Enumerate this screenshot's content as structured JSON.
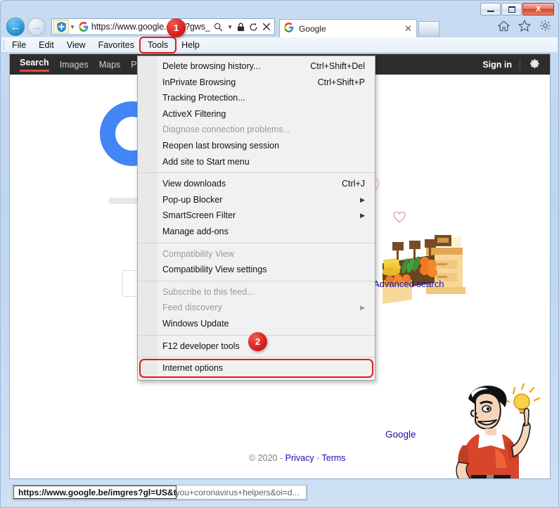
{
  "window": {
    "minimize_label": "Minimize",
    "maximize_label": "Maximize",
    "close_label": "X"
  },
  "navigation": {
    "back_label": "←",
    "forward_label": "→",
    "shield_icon": "tracking-protection-shield-icon",
    "url": "https://www.google.com/?gws_",
    "search_icon": "search-magnifier-icon",
    "dropdown_icon": "chevron-down-icon",
    "lock_icon": "padlock-icon",
    "refresh_icon": "refresh-icon",
    "stop_icon": "stop-x-icon"
  },
  "tabs": {
    "items": [
      {
        "title": "Google",
        "favicon": "google-g-favicon",
        "close_label": "✕"
      }
    ],
    "new_tab_label": "New Tab"
  },
  "toolbar_icons": [
    {
      "name": "home-icon",
      "glyph": "⌂"
    },
    {
      "name": "favorites-star-icon",
      "glyph": "☆"
    },
    {
      "name": "settings-gear-icon",
      "glyph": "⚙"
    }
  ],
  "menubar": {
    "items": [
      {
        "label": "File"
      },
      {
        "label": "Edit"
      },
      {
        "label": "View"
      },
      {
        "label": "Favorites"
      },
      {
        "label": "Tools",
        "highlighted": true
      },
      {
        "label": "Help"
      }
    ]
  },
  "tools_menu": {
    "groups": [
      {
        "items": [
          {
            "label": "Delete browsing history...",
            "accel": "Ctrl+Shift+Del",
            "disabled": false,
            "submenu": false
          },
          {
            "label": "InPrivate Browsing",
            "accel": "Ctrl+Shift+P",
            "disabled": false,
            "submenu": false
          },
          {
            "label": "Tracking Protection...",
            "accel": "",
            "disabled": false,
            "submenu": false
          },
          {
            "label": "ActiveX Filtering",
            "accel": "",
            "disabled": false,
            "submenu": false
          },
          {
            "label": "Diagnose connection problems...",
            "accel": "",
            "disabled": true,
            "submenu": false
          },
          {
            "label": "Reopen last browsing session",
            "accel": "",
            "disabled": false,
            "submenu": false
          },
          {
            "label": "Add site to Start menu",
            "accel": "",
            "disabled": false,
            "submenu": false
          }
        ]
      },
      {
        "items": [
          {
            "label": "View downloads",
            "accel": "Ctrl+J",
            "disabled": false,
            "submenu": false
          },
          {
            "label": "Pop-up Blocker",
            "accel": "",
            "disabled": false,
            "submenu": true
          },
          {
            "label": "SmartScreen Filter",
            "accel": "",
            "disabled": false,
            "submenu": true
          },
          {
            "label": "Manage add-ons",
            "accel": "",
            "disabled": false,
            "submenu": false
          }
        ]
      },
      {
        "items": [
          {
            "label": "Compatibility View",
            "accel": "",
            "disabled": true,
            "submenu": false
          },
          {
            "label": "Compatibility View settings",
            "accel": "",
            "disabled": false,
            "submenu": false
          }
        ]
      },
      {
        "items": [
          {
            "label": "Subscribe to this feed...",
            "accel": "",
            "disabled": true,
            "submenu": false
          },
          {
            "label": "Feed discovery",
            "accel": "",
            "disabled": true,
            "submenu": true
          },
          {
            "label": "Windows Update",
            "accel": "",
            "disabled": false,
            "submenu": false
          }
        ]
      },
      {
        "items": [
          {
            "label": "F12 developer tools",
            "accel": "",
            "disabled": false,
            "submenu": false
          }
        ]
      },
      {
        "items": [
          {
            "label": "Internet options",
            "accel": "",
            "disabled": false,
            "submenu": false,
            "highlighted": true
          }
        ]
      }
    ]
  },
  "badges": [
    {
      "id": "badge-1",
      "label": "1"
    },
    {
      "id": "badge-2",
      "label": "2"
    }
  ],
  "page": {
    "gbar": {
      "links": [
        {
          "label": "Search",
          "active": true
        },
        {
          "label": "Images",
          "active": false
        },
        {
          "label": "Maps",
          "active": false
        },
        {
          "label": "Play",
          "active": false
        }
      ],
      "signin_label": "Sign in",
      "gear_icon": "google-settings-gear-icon"
    },
    "doodle": {
      "alt": "Thank you coronavirus helpers - grocery workers doodle"
    },
    "search": {
      "value": "",
      "placeholder": ""
    },
    "advanced_search_label": "Advanced search",
    "google_link_label": "Google",
    "footer": {
      "copyright": "© 2020",
      "sep1": "-",
      "privacy": "Privacy",
      "sep2": "-",
      "terms": "Terms"
    },
    "mascot_alt": "cartoon man with idea lightbulb"
  },
  "statusbar": {
    "long_url": "https://www.google.com/search?q=thank+you+coronavirus+helpers&oi=d...",
    "tooltip_url": "https://www.google.be/imgres?gl=US&tbm=..."
  },
  "colors": {
    "accent_red": "#e01b1b",
    "google_blue": "#4285f4",
    "link_blue": "#1a0dab",
    "gbar_dark": "#2d2d2d"
  }
}
